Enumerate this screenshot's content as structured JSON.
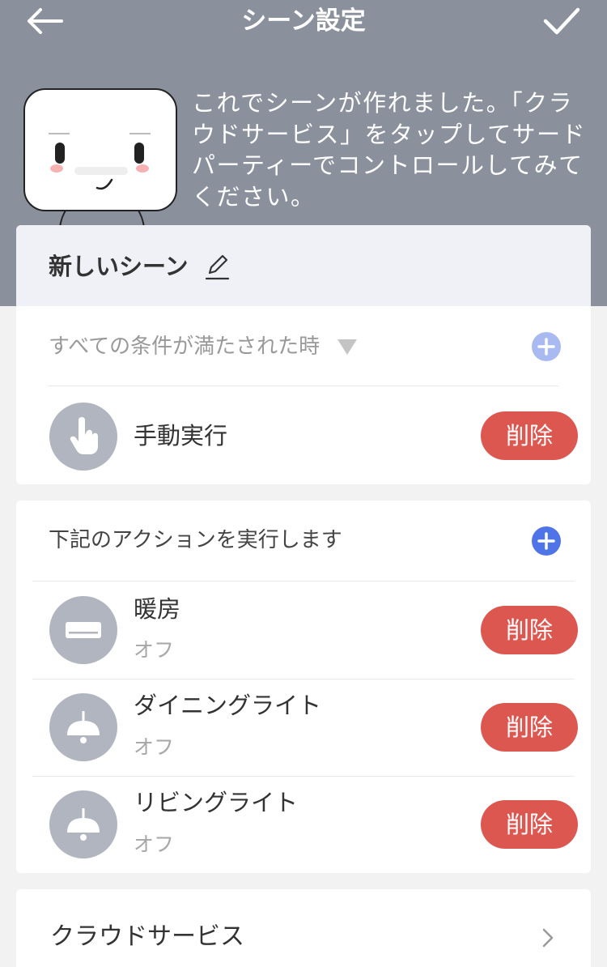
{
  "nav": {
    "title": "シーン設定",
    "back_icon": "arrow-left-icon",
    "confirm_icon": "checkmark-icon"
  },
  "intro": {
    "text": "これでシーンが作れました。「クラウドサービス」をタップしてサードパーティーでコントロールしてみてください。"
  },
  "scene": {
    "name": "新しいシーン",
    "edit_icon": "pencil-icon"
  },
  "conditions": {
    "label": "すべての条件が満たされた時",
    "dropdown_icon": "triangle-down-icon",
    "add_icon": "plus-circle-icon",
    "items": [
      {
        "title": "手動実行",
        "icon": "hand-tap-icon",
        "delete_label": "削除"
      }
    ]
  },
  "actions": {
    "label": "下記のアクションを実行します",
    "add_icon": "plus-circle-icon",
    "items": [
      {
        "title": "暖房",
        "status": "オフ",
        "icon": "air-conditioner-icon",
        "delete_label": "削除"
      },
      {
        "title": "ダイニングライト",
        "status": "オフ",
        "icon": "pendant-light-icon",
        "delete_label": "削除"
      },
      {
        "title": "リビングライト",
        "status": "オフ",
        "icon": "pendant-light-icon",
        "delete_label": "削除"
      }
    ]
  },
  "cloud": {
    "label": "クラウドサービス",
    "chevron_icon": "chevron-right-icon"
  },
  "colors": {
    "header_bg": "#8a909c",
    "delete": "#dc5750",
    "add_active": "#4f74e8",
    "add_inactive": "#a9b9f2",
    "icon_circle": "#b1b5bf"
  }
}
